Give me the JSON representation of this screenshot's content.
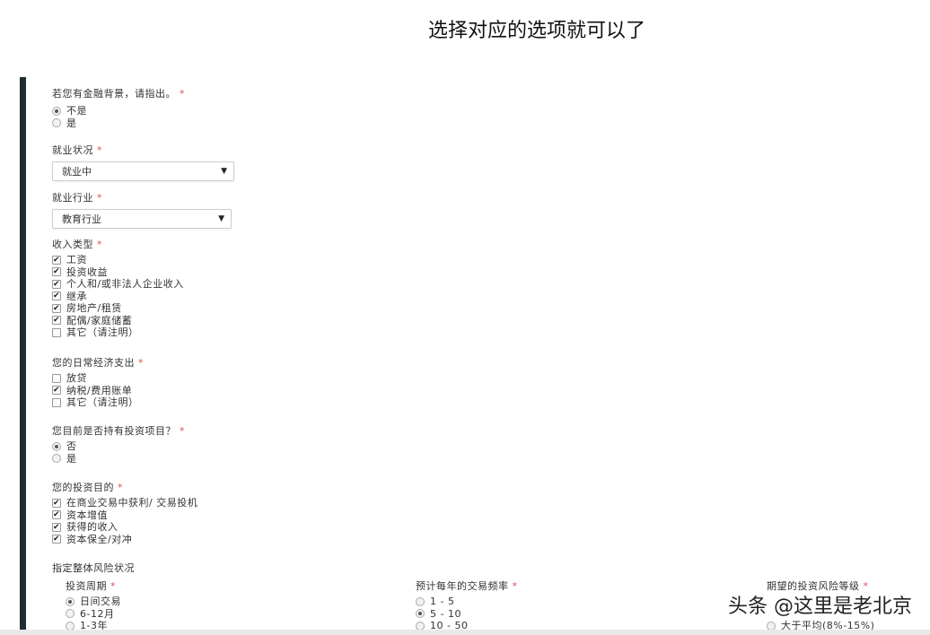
{
  "caption": "选择对应的选项就可以了",
  "watermark": "头条 @这里是老北京",
  "q_finance": {
    "label": "若您有金融背景，请指出。",
    "required": "*",
    "options": [
      {
        "label": "不是",
        "selected": true
      },
      {
        "label": "是",
        "selected": false
      }
    ]
  },
  "q_employment": {
    "label": "就业状况",
    "required": "*",
    "value": "就业中"
  },
  "q_industry": {
    "label": "就业行业",
    "required": "*",
    "value": "教育行业"
  },
  "q_income": {
    "label": "收入类型",
    "required": "*",
    "options": [
      {
        "label": "工资",
        "checked": true
      },
      {
        "label": "投资收益",
        "checked": true
      },
      {
        "label": "个人和/或非法人企业收入",
        "checked": true
      },
      {
        "label": "继承",
        "checked": true
      },
      {
        "label": "房地产/租赁",
        "checked": true
      },
      {
        "label": "配偶/家庭储蓄",
        "checked": true
      },
      {
        "label": "其它（请注明）",
        "checked": false
      }
    ]
  },
  "q_expense": {
    "label": "您的日常经济支出",
    "required": "*",
    "options": [
      {
        "label": "放贷",
        "checked": false
      },
      {
        "label": "纳税/费用账单",
        "checked": true
      },
      {
        "label": "其它（请注明）",
        "checked": false
      }
    ]
  },
  "q_holding": {
    "label": "您目前是否持有投资项目？",
    "required": "*",
    "options": [
      {
        "label": "否",
        "selected": true
      },
      {
        "label": "是",
        "selected": false
      }
    ]
  },
  "q_purpose": {
    "label": "您的投资目的",
    "required": "*",
    "options": [
      {
        "label": "在商业交易中获利/ 交易投机",
        "checked": true
      },
      {
        "label": "资本增值",
        "checked": true
      },
      {
        "label": "获得的收入",
        "checked": true
      },
      {
        "label": "资本保全/对冲",
        "checked": true
      }
    ]
  },
  "risk": {
    "title": "指定整体风险状况",
    "period": {
      "label": "投资周期",
      "required": "*",
      "options": [
        {
          "label": "日间交易",
          "selected": true
        },
        {
          "label": "6-12月",
          "selected": false
        },
        {
          "label": "1-3年",
          "selected": false
        }
      ]
    },
    "frequency": {
      "label": "预计每年的交易频率",
      "required": "*",
      "options": [
        {
          "label": "1 - 5",
          "selected": false
        },
        {
          "label": "5 - 10",
          "selected": true
        },
        {
          "label": "10 - 50",
          "selected": false
        }
      ]
    },
    "level": {
      "label": "期望的投资风险等级",
      "required": "*",
      "options": [
        {
          "label": "大于平均(8%-15%)",
          "selected": false
        }
      ]
    }
  },
  "colors": {
    "accent_bar": "#1f2d33",
    "required": "#d9534f"
  }
}
